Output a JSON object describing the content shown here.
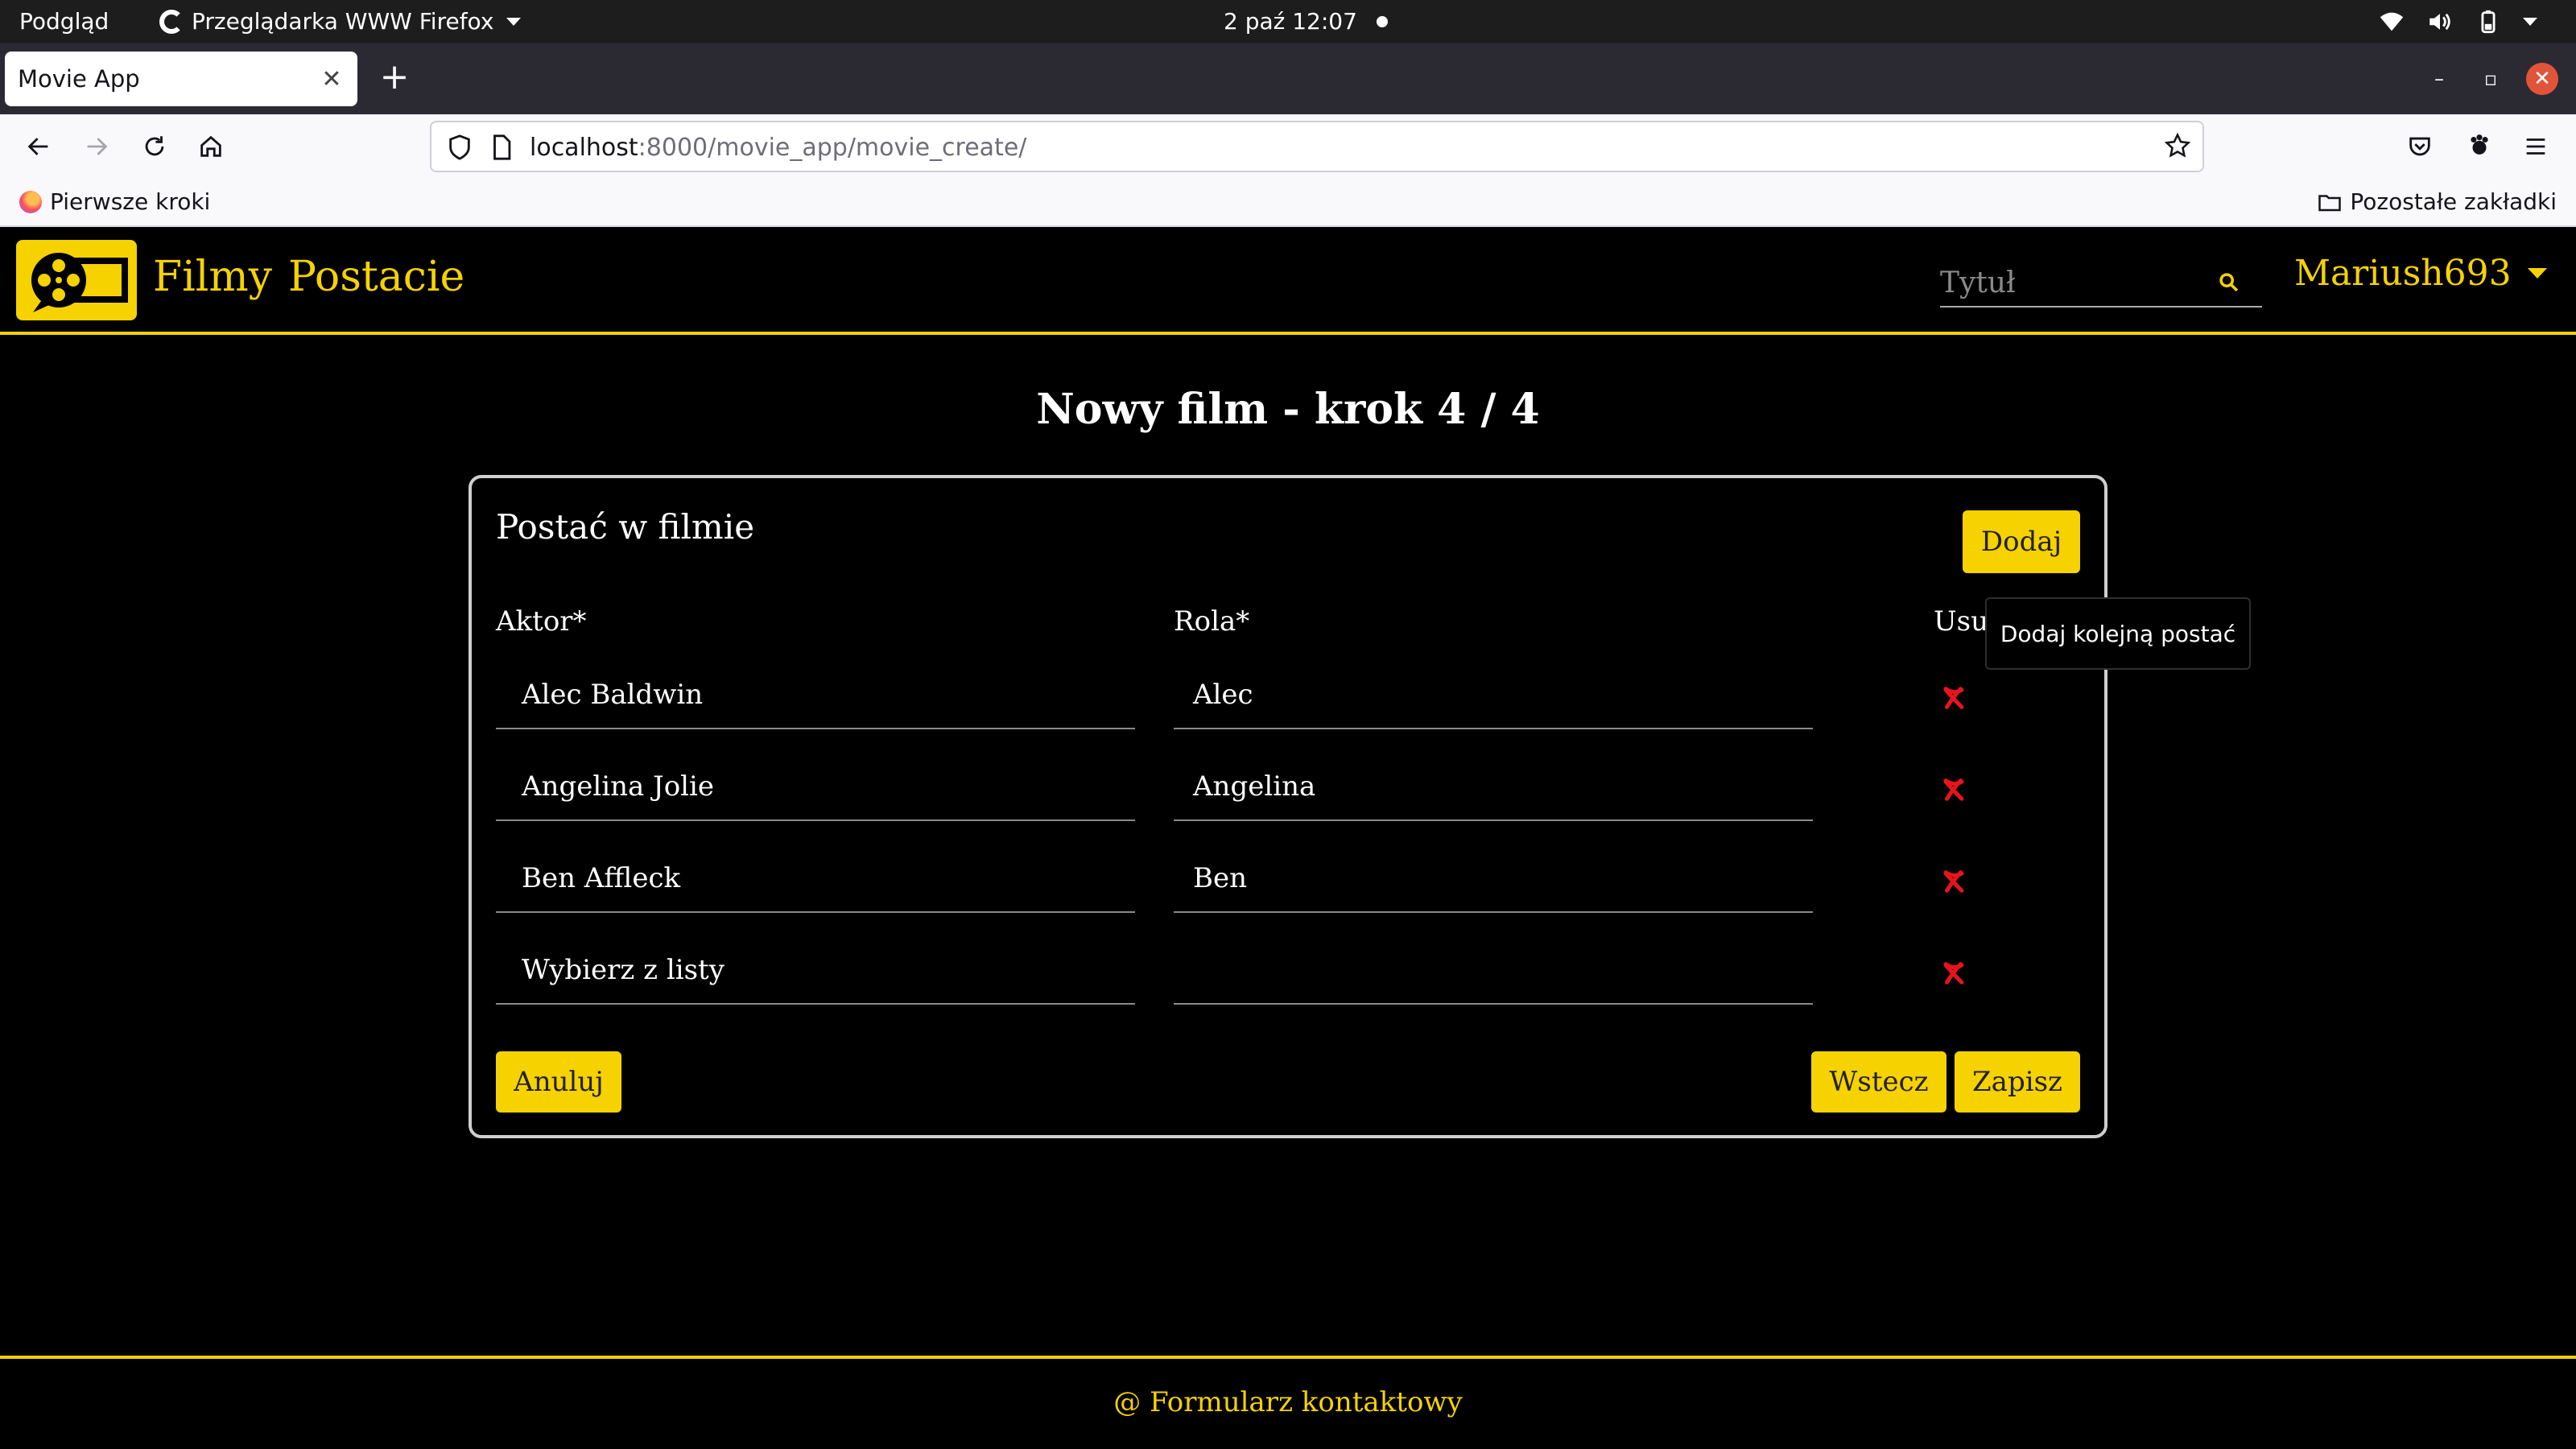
{
  "os": {
    "activities": "Podgląd",
    "app_name": "Przeglądarka WWW Firefox",
    "datetime": "2 paź  12:07"
  },
  "browser": {
    "tab_title": "Movie App",
    "url_host": "localhost",
    "url_path": ":8000/movie_app/movie_create/",
    "bookmark_first": "Pierwsze kroki",
    "bookmark_other": "Pozostałe zakładki"
  },
  "header": {
    "nav_films": "Filmy",
    "nav_characters": "Postacie",
    "search_placeholder": "Tytuł",
    "username": "Mariush693"
  },
  "page": {
    "title": "Nowy film - krok 4 / 4"
  },
  "form": {
    "card_title": "Postać w filmie",
    "add_label": "Dodaj",
    "col_actor": "Aktor*",
    "col_role": "Rola*",
    "col_remove": "Usuń",
    "rows": [
      {
        "actor": "Alec Baldwin",
        "role": "Alec"
      },
      {
        "actor": "Angelina Jolie",
        "role": "Angelina"
      },
      {
        "actor": "Ben Affleck",
        "role": "Ben"
      },
      {
        "actor": "Wybierz z listy",
        "role": ""
      }
    ],
    "cancel_label": "Anuluj",
    "back_label": "Wstecz",
    "save_label": "Zapisz",
    "tooltip": "Dodaj kolejną postać"
  },
  "footer": {
    "contact_link": "@ Formularz kontaktowy"
  },
  "colors": {
    "accent": "#f5d200",
    "remove": "#e8141c"
  }
}
